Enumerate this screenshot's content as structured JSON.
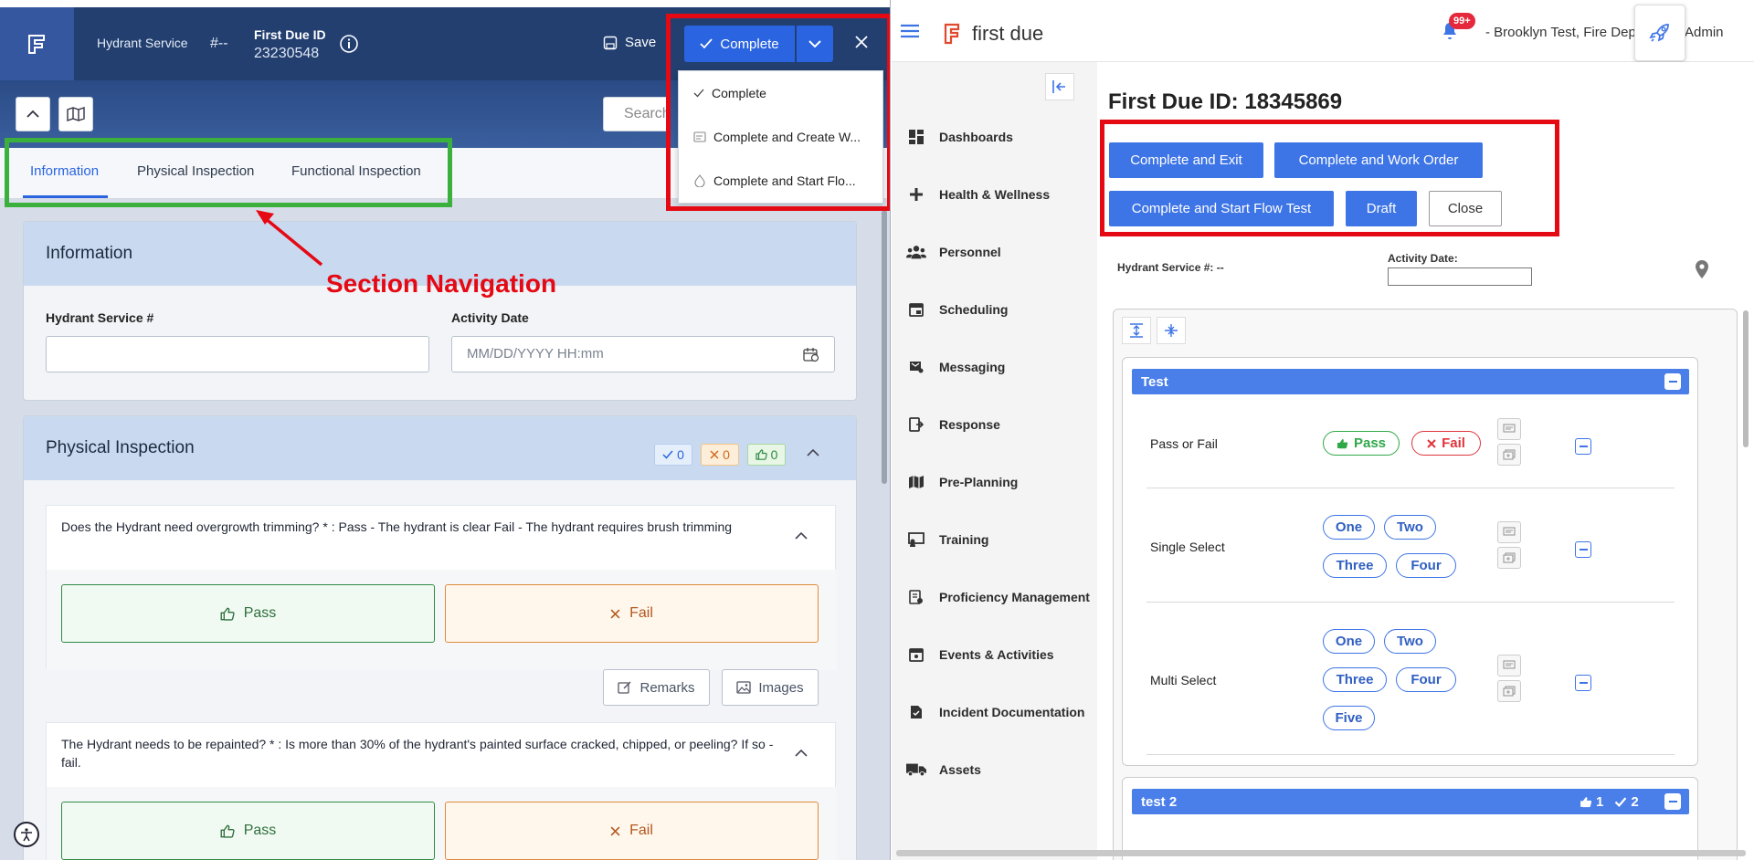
{
  "left": {
    "header": {
      "service": "Hydrant Service",
      "number": "#--",
      "fdid_label": "First Due ID",
      "fdid_value": "23230548",
      "save": "Save",
      "complete": "Complete"
    },
    "search": {
      "placeholder": "Search"
    },
    "tabs": [
      "Information",
      "Physical Inspection",
      "Functional Inspection"
    ],
    "annotation": "Section Navigation",
    "information": {
      "title": "Information",
      "service_label": "Hydrant Service #",
      "service_value": "",
      "date_label": "Activity Date",
      "date_placeholder": "MM/DD/YYYY HH:mm"
    },
    "physical": {
      "title": "Physical Inspection",
      "counts": {
        "check": "0",
        "x": "0",
        "thumb": "0"
      },
      "questions": [
        {
          "text": "Does the Hydrant need overgrowth trimming? * : Pass - The hydrant is clear Fail - The hydrant requires brush trimming",
          "pass": "Pass",
          "fail": "Fail"
        },
        {
          "text": "The Hydrant needs to be repainted? * : Is more than 30% of the hydrant's painted surface cracked, chipped, or peeling? If so - fail.",
          "pass": "Pass",
          "fail": "Fail"
        }
      ],
      "remarks": "Remarks",
      "images": "Images"
    },
    "dropdown": [
      "Complete",
      "Complete and Create W...",
      "Complete and Start Flo..."
    ]
  },
  "right": {
    "brand": "first due",
    "notif": "99+",
    "user": "- Brooklyn Test, Fire Dep",
    "user_suffix": "Admin",
    "nav": [
      "Dashboards",
      "Health & Wellness",
      "Personnel",
      "Scheduling",
      "Messaging",
      "Response",
      "Pre-Planning",
      "Training",
      "Proficiency Management",
      "Events & Activities",
      "Incident Documentation",
      "Assets"
    ],
    "title": "First Due ID: 18345869",
    "buttons": {
      "exit": "Complete and Exit",
      "wo": "Complete and Work Order",
      "flow": "Complete and Start Flow Test",
      "draft": "Draft",
      "close": "Close"
    },
    "service_label": "Hydrant Service #: --",
    "date_label": "Activity Date:",
    "sections": {
      "test": "Test",
      "rows": [
        {
          "label": "Pass or Fail",
          "options": [
            "Pass",
            "Fail"
          ]
        },
        {
          "label": "Single Select",
          "options": [
            "One",
            "Two",
            "Three",
            "Four"
          ]
        },
        {
          "label": "Multi Select",
          "options": [
            "One",
            "Two",
            "Three",
            "Four",
            "Five"
          ]
        }
      ],
      "test2": "test 2",
      "test2_thumb": "1",
      "test2_check": "2"
    },
    "colors": {
      "accent": "#3d74e6",
      "highlight_red": "#e50914",
      "highlight_green": "#3cb03c"
    }
  }
}
